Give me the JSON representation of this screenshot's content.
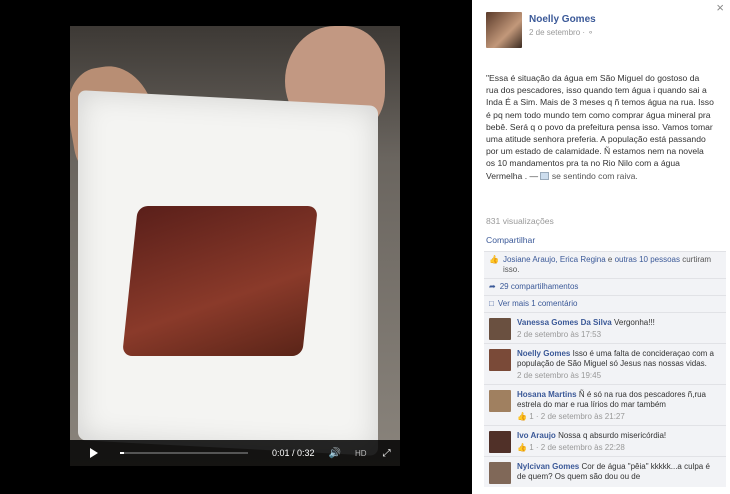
{
  "video": {
    "time": "0:01 / 0:32",
    "hd_label": "HD",
    "progress": 0.03
  },
  "post": {
    "author": "Noelly Gomes",
    "date": "2 de setembro · ",
    "text": "\"Essa é situação da água em São Miguel do gostoso da rua dos pescadores, isso quando tem água i quando sai a Inda É a Sim. Mais de 3 meses q ñ temos água na rua. Isso é pq nem todo mundo tem como comprar água mineral pra bebê. Será q o povo da prefeitura pensa isso. Vamos tomar uma atitude senhora preferia. A população está passando por um estado de calamidade. Ñ estamos nem na novela os 10 mandamentos pra ta no Rio Nilo com a água Vermelha . — ",
    "feeling": "se sentindo com raiva.",
    "views": "831 visualizações",
    "share": "Compartilhar",
    "likes_names": "Josiane Araujo, Erica Regina",
    "likes_and": " e ",
    "likes_others": "outras 10 pessoas",
    "likes_suffix": " curtiram isso.",
    "shares": "29 compartilhamentos",
    "more_comments": "Ver mais 1 comentário"
  },
  "comments": [
    {
      "name": "Vanessa Gomes Da Silva",
      "text": "Vergonha!!!",
      "meta": "2 de setembro às 17:53",
      "likes": "",
      "color": "#6a5040"
    },
    {
      "name": "Noelly Gomes",
      "text": "Isso é uma falta de concideraçao com a população de São Miguel só Jesus nas nossas vidas.",
      "meta": "2 de setembro às 19:45",
      "likes": "",
      "color": "#7a4a38"
    },
    {
      "name": "Hosana Martins",
      "text": "Ñ é só na rua dos pescadores ñ,rua estrela do mar e rua lírios do mar também",
      "meta": "2 de setembro às 21:27",
      "likes": "1",
      "color": "#a08060"
    },
    {
      "name": "Ivo Araujo",
      "text": "Nossa q absurdo misericórdia!",
      "meta": "2 de setembro às 22:28",
      "likes": "1",
      "color": "#503028"
    },
    {
      "name": "Nylcivan Gomes",
      "text": "Cor de água \"pêia\" kkkkk...a culpa é de quem? Os quem são dou ou de",
      "meta": "",
      "likes": "",
      "color": "#806858"
    }
  ],
  "icons": {
    "close": "close-icon",
    "play": "play-icon",
    "volume": "volume-icon",
    "fullscreen": "fullscreen-icon",
    "globe": "globe-icon",
    "like": "like-icon",
    "share": "share-icon",
    "comment": "comment-icon"
  }
}
